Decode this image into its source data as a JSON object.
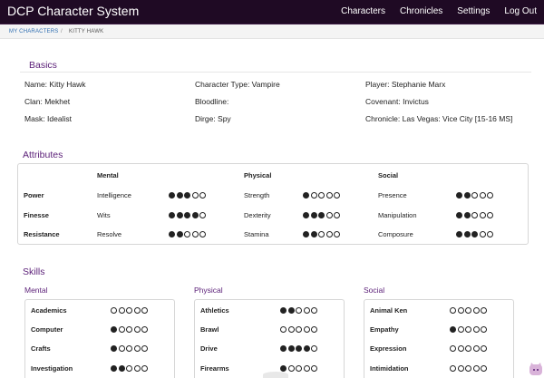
{
  "nav": {
    "brand": "DCP Character System",
    "links": [
      "Characters",
      "Chronicles",
      "Settings",
      "Log Out"
    ]
  },
  "breadcrumb": {
    "root": "MY CHARACTERS",
    "separator": "/",
    "current": "KITTY HAWK"
  },
  "basics": {
    "title": "Basics",
    "fields": [
      "Name: Kitty Hawk",
      "Character Type: Vampire",
      "Player: Stephanie Marx",
      "Clan: Mekhet",
      "Bloodline:",
      "Covenant: Invictus",
      "Mask: Idealist",
      "Dirge: Spy",
      "Chronicle: Las Vegas: Vice City [15-16 MS]"
    ]
  },
  "attributes": {
    "title": "Attributes",
    "groups": [
      "Mental",
      "Physical",
      "Social"
    ],
    "rows": [
      {
        "label": "Power",
        "items": [
          {
            "name": "Intelligence",
            "value": 3
          },
          {
            "name": "Strength",
            "value": 1
          },
          {
            "name": "Presence",
            "value": 2
          }
        ]
      },
      {
        "label": "Finesse",
        "items": [
          {
            "name": "Wits",
            "value": 4
          },
          {
            "name": "Dexterity",
            "value": 3
          },
          {
            "name": "Manipulation",
            "value": 2
          }
        ]
      },
      {
        "label": "Resistance",
        "items": [
          {
            "name": "Resolve",
            "value": 2
          },
          {
            "name": "Stamina",
            "value": 2
          },
          {
            "name": "Composure",
            "value": 3
          }
        ]
      }
    ]
  },
  "skills": {
    "title": "Skills",
    "columns": [
      {
        "name": "Mental",
        "items": [
          {
            "name": "Academics",
            "value": 0
          },
          {
            "name": "Computer",
            "value": 1
          },
          {
            "name": "Crafts",
            "value": 1
          },
          {
            "name": "Investigation",
            "value": 2
          }
        ]
      },
      {
        "name": "Physical",
        "items": [
          {
            "name": "Athletics",
            "value": 2
          },
          {
            "name": "Brawl",
            "value": 0
          },
          {
            "name": "Drive",
            "value": 4
          },
          {
            "name": "Firearms",
            "value": 1
          }
        ]
      },
      {
        "name": "Social",
        "items": [
          {
            "name": "Animal Ken",
            "value": 0
          },
          {
            "name": "Empathy",
            "value": 1
          },
          {
            "name": "Expression",
            "value": 0
          },
          {
            "name": "Intimidation",
            "value": 0
          }
        ]
      }
    ]
  },
  "max_dots": 5,
  "colors": {
    "navbar": "#1f0a24",
    "section_title": "#5a1e77",
    "link": "#2b6cb0"
  },
  "icons": {
    "floating_helper": "octocat-icon"
  }
}
